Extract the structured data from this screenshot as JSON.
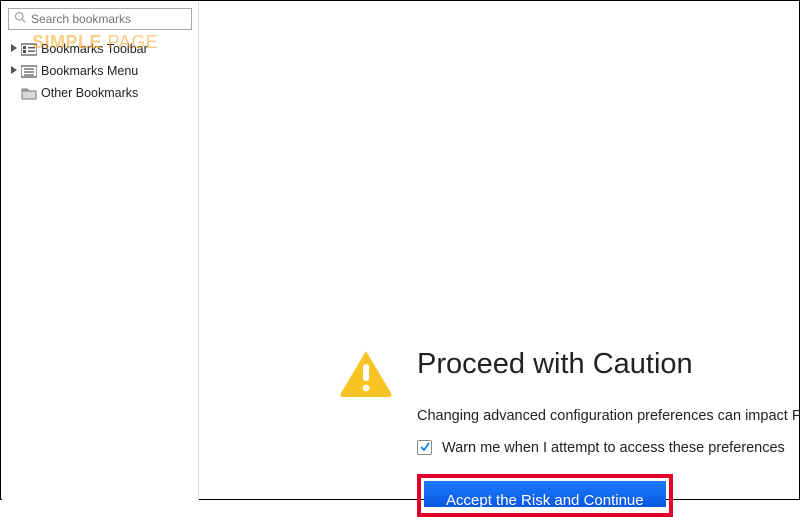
{
  "watermark": {
    "part1": "SIMPLE",
    "part2": " PAGE"
  },
  "sidebar": {
    "search_placeholder": "Search bookmarks",
    "items": [
      {
        "label": "Bookmarks Toolbar",
        "expandable": true
      },
      {
        "label": "Bookmarks Menu",
        "expandable": true
      },
      {
        "label": "Other Bookmarks",
        "expandable": false
      }
    ]
  },
  "warning": {
    "title": "Proceed with Caution",
    "description": "Changing advanced configuration preferences can impact Fire",
    "checkbox_checked": true,
    "checkbox_label": "Warn me when I attempt to access these preferences",
    "accept_label": "Accept the Risk and Continue"
  },
  "colors": {
    "accent_blue": "#0a6cff",
    "warn_yellow": "#f5c518",
    "highlight_red": "#e4002b"
  }
}
